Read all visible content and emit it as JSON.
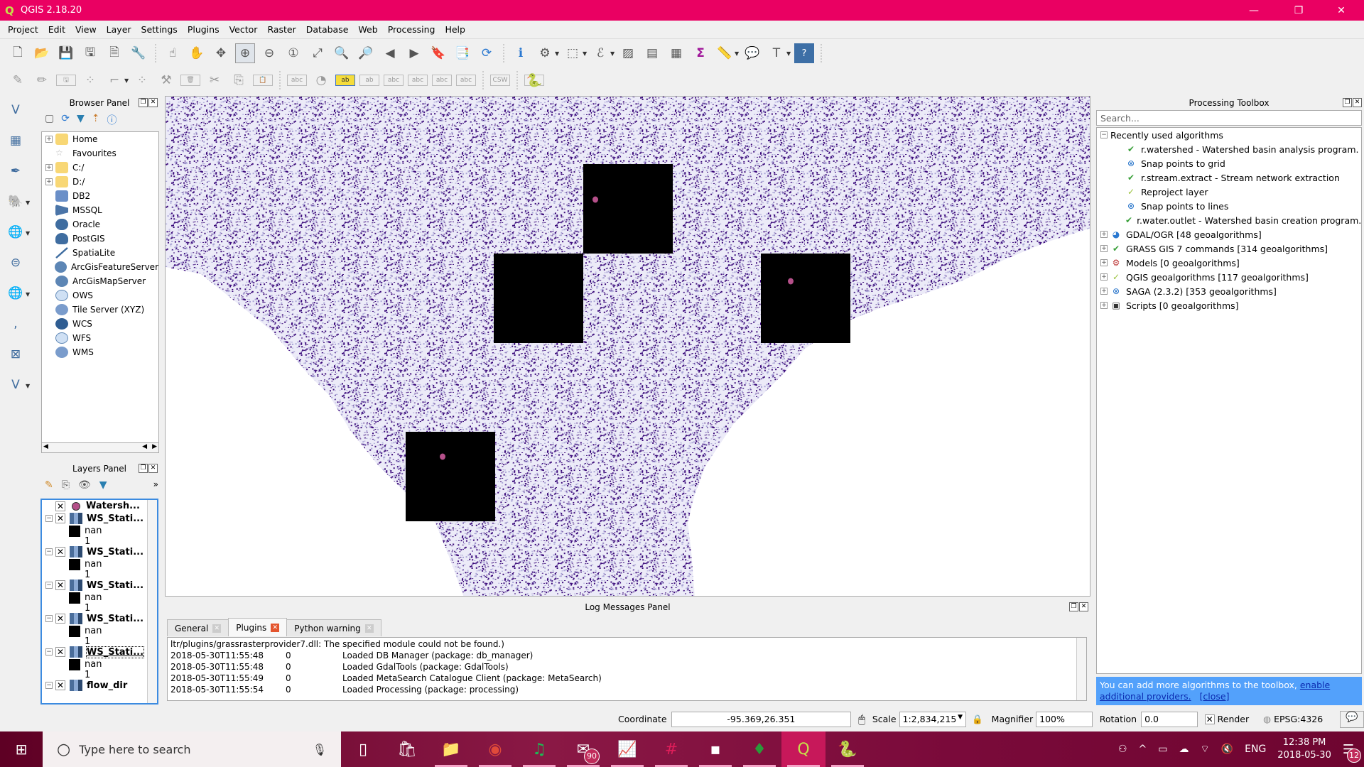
{
  "window": {
    "title": "QGIS 2.18.20",
    "minimize": "—",
    "restore": "❐",
    "close": "✕"
  },
  "menu": [
    "Project",
    "Edit",
    "View",
    "Layer",
    "Settings",
    "Plugins",
    "Vector",
    "Raster",
    "Database",
    "Web",
    "Processing",
    "Help"
  ],
  "toolbar1": [
    {
      "icon": "new-project-icon",
      "glyph": "🗋"
    },
    {
      "icon": "open-project-icon",
      "glyph": "📂"
    },
    {
      "icon": "save-project-icon",
      "glyph": "💾"
    },
    {
      "icon": "save-as-icon",
      "glyph": "🖫"
    },
    {
      "icon": "new-print-composer-icon",
      "glyph": "🗎"
    },
    {
      "icon": "composer-manager-icon",
      "glyph": "🔧"
    },
    {
      "icon": "touch-zoom-icon",
      "glyph": "☝"
    },
    {
      "icon": "pan-icon",
      "glyph": "✋"
    },
    {
      "icon": "pan-to-selection-icon",
      "glyph": "✥"
    },
    {
      "icon": "zoom-in-icon",
      "glyph": "⊕"
    },
    {
      "icon": "zoom-out-icon",
      "glyph": "⊖"
    },
    {
      "icon": "zoom-native-icon",
      "glyph": "①"
    },
    {
      "icon": "zoom-full-icon",
      "glyph": "⤢"
    },
    {
      "icon": "zoom-to-selection-icon",
      "glyph": "🔍"
    },
    {
      "icon": "zoom-to-layer-icon",
      "glyph": "🔎"
    },
    {
      "icon": "zoom-last-icon",
      "glyph": "◀"
    },
    {
      "icon": "zoom-next-icon",
      "glyph": "▶"
    },
    {
      "icon": "new-bookmark-icon",
      "glyph": "🔖"
    },
    {
      "icon": "show-bookmarks-icon",
      "glyph": "📑"
    },
    {
      "icon": "refresh-icon",
      "glyph": "⟳"
    },
    {
      "icon": "identify-icon",
      "glyph": "ℹ"
    },
    {
      "icon": "run-feature-action-icon",
      "glyph": "⚙"
    },
    {
      "icon": "select-features-icon",
      "glyph": "⬚"
    },
    {
      "icon": "select-by-expression-icon",
      "glyph": "ℰ"
    },
    {
      "icon": "deselect-all-icon",
      "glyph": "▨"
    },
    {
      "icon": "attribute-table-icon",
      "glyph": "▤"
    },
    {
      "icon": "field-calculator-icon",
      "glyph": "▦"
    },
    {
      "icon": "statistical-summary-icon",
      "glyph": "Σ"
    },
    {
      "icon": "measure-icon",
      "glyph": "📏"
    },
    {
      "icon": "map-tips-icon",
      "glyph": "💬"
    },
    {
      "icon": "text-annotation-icon",
      "glyph": "T"
    },
    {
      "icon": "help-icon",
      "glyph": "?"
    }
  ],
  "toolbar2": [
    {
      "icon": "current-edits-icon",
      "glyph": "✎"
    },
    {
      "icon": "toggle-editing-icon",
      "glyph": "✏"
    },
    {
      "icon": "save-edits-icon",
      "glyph": "🖫"
    },
    {
      "icon": "add-feature-icon",
      "glyph": "⁘"
    },
    {
      "icon": "node-tool-icon",
      "glyph": "⌐"
    },
    {
      "icon": "move-feature-icon",
      "glyph": "⁘"
    },
    {
      "icon": "vertex-tool-icon",
      "glyph": "⚒"
    },
    {
      "icon": "delete-selected-icon",
      "glyph": "🗑"
    },
    {
      "icon": "cut-features-icon",
      "glyph": "✂"
    },
    {
      "icon": "copy-features-icon",
      "glyph": "⎘"
    },
    {
      "icon": "paste-features-icon",
      "glyph": "📋"
    },
    {
      "icon": "label-toolbar-icon",
      "glyph": "abc"
    },
    {
      "icon": "diagram-icon",
      "glyph": "◔"
    },
    {
      "icon": "pin-labels-icon",
      "glyph": "ab"
    },
    {
      "icon": "highlight-pinned-icon",
      "glyph": "ab"
    },
    {
      "icon": "show-hide-labels-icon",
      "glyph": "abc"
    },
    {
      "icon": "move-label-icon",
      "glyph": "abc"
    },
    {
      "icon": "rotate-label-icon",
      "glyph": "abc"
    },
    {
      "icon": "change-label-icon",
      "glyph": "abc"
    },
    {
      "icon": "csw-icon",
      "glyph": "CSW"
    },
    {
      "icon": "python-console-icon",
      "glyph": "🐍"
    }
  ],
  "left_toolbar": [
    "add-vector-layer-icon",
    "add-raster-layer-icon",
    "add-spatialite-layer-icon",
    "add-postgis-layer-icon",
    "add-wms-layer-icon",
    "add-wcs-layer-icon",
    "add-wfs-layer-icon",
    "add-delimited-text-icon",
    "add-mssql-layer-icon",
    "new-shapefile-icon"
  ],
  "browser_panel": {
    "title": "Browser Panel",
    "items": [
      {
        "label": "Home",
        "icon": "folder-icon",
        "expandable": true
      },
      {
        "label": "Favourites",
        "icon": "star-icon",
        "expandable": false
      },
      {
        "label": "C:/",
        "icon": "folder-icon",
        "expandable": true
      },
      {
        "label": "D:/",
        "icon": "folder-icon",
        "expandable": true
      },
      {
        "label": "DB2",
        "icon": "db2-icon",
        "expandable": false
      },
      {
        "label": "MSSQL",
        "icon": "mssql-icon",
        "expandable": false
      },
      {
        "label": "Oracle",
        "icon": "oracle-icon",
        "expandable": false
      },
      {
        "label": "PostGIS",
        "icon": "postgis-icon",
        "expandable": false
      },
      {
        "label": "SpatiaLite",
        "icon": "spatialite-icon",
        "expandable": false
      },
      {
        "label": "ArcGisFeatureServer",
        "icon": "arcgis-feature-icon",
        "expandable": false
      },
      {
        "label": "ArcGisMapServer",
        "icon": "arcgis-map-icon",
        "expandable": false
      },
      {
        "label": "OWS",
        "icon": "ows-icon",
        "expandable": false
      },
      {
        "label": "Tile Server (XYZ)",
        "icon": "xyz-icon",
        "expandable": false
      },
      {
        "label": "WCS",
        "icon": "wcs-icon",
        "expandable": false
      },
      {
        "label": "WFS",
        "icon": "wfs-icon",
        "expandable": false
      },
      {
        "label": "WMS",
        "icon": "wms-icon",
        "expandable": false
      }
    ]
  },
  "layers_panel": {
    "title": "Layers Panel",
    "layers": [
      {
        "name": "Watersh...",
        "type": "point",
        "checked": true,
        "legend": []
      },
      {
        "name": "WS_Stati...",
        "type": "raster",
        "checked": true,
        "legend": [
          "nan",
          "1"
        ]
      },
      {
        "name": "WS_Stati...",
        "type": "raster",
        "checked": true,
        "legend": [
          "nan",
          "1"
        ]
      },
      {
        "name": "WS_Stati...",
        "type": "raster",
        "checked": true,
        "legend": [
          "nan",
          "1"
        ]
      },
      {
        "name": "WS_Stati...",
        "type": "raster",
        "checked": true,
        "legend": [
          "nan",
          "1"
        ]
      },
      {
        "name": "WS_Stati...",
        "type": "raster",
        "checked": true,
        "legend": [
          "nan",
          "1"
        ],
        "selected": true
      },
      {
        "name": "flow_dir",
        "type": "raster",
        "checked": true,
        "legend": []
      }
    ]
  },
  "map": {
    "raster_color": "#3b0a7a",
    "point_color": "#b5508a",
    "watershed_fill": "#000000"
  },
  "log_panel": {
    "title": "Log Messages Panel",
    "tabs": [
      {
        "label": "General",
        "active": false
      },
      {
        "label": "Plugins",
        "active": true
      },
      {
        "label": "Python warning",
        "active": false
      }
    ],
    "first_line": "ltr/plugins/grassrasterprovider7.dll: The specified module could not be found.)",
    "entries": [
      {
        "ts": "2018-05-30T11:55:48",
        "level": "0",
        "msg": "Loaded DB Manager (package: db_manager)"
      },
      {
        "ts": "2018-05-30T11:55:48",
        "level": "0",
        "msg": "Loaded GdalTools (package: GdalTools)"
      },
      {
        "ts": "2018-05-30T11:55:49",
        "level": "0",
        "msg": "Loaded MetaSearch Catalogue Client (package: MetaSearch)"
      },
      {
        "ts": "2018-05-30T11:55:54",
        "level": "0",
        "msg": "Loaded Processing (package: processing)"
      }
    ]
  },
  "processing": {
    "title": "Processing Toolbox",
    "search_placeholder": "Search...",
    "recent_label": "Recently used algorithms",
    "recent": [
      {
        "label": "r.watershed - Watershed basin analysis program.",
        "icon": "grass-icon"
      },
      {
        "label": "Snap points to grid",
        "icon": "saga-icon"
      },
      {
        "label": "r.stream.extract - Stream network extraction",
        "icon": "grass-icon"
      },
      {
        "label": "Reproject layer",
        "icon": "qgis-icon"
      },
      {
        "label": "Snap points to lines",
        "icon": "saga-icon"
      },
      {
        "label": "r.water.outlet - Watershed basin creation program.",
        "icon": "grass-icon"
      }
    ],
    "providers": [
      {
        "label": "GDAL/OGR [48 geoalgorithms]",
        "icon": "gdal-icon"
      },
      {
        "label": "GRASS GIS 7 commands [314 geoalgorithms]",
        "icon": "grass-icon"
      },
      {
        "label": "Models [0 geoalgorithms]",
        "icon": "models-icon"
      },
      {
        "label": "QGIS geoalgorithms [117 geoalgorithms]",
        "icon": "qgis-icon"
      },
      {
        "label": "SAGA (2.3.2) [353 geoalgorithms]",
        "icon": "saga-icon"
      },
      {
        "label": "Scripts [0 geoalgorithms]",
        "icon": "scripts-icon"
      }
    ],
    "info_text": "You can add more algorithms to the toolbox, ",
    "info_link": "enable additional providers.",
    "info_close": "[close]"
  },
  "statusbar": {
    "coordinate_label": "Coordinate",
    "coordinate": "-95.369,26.351",
    "scale_label": "Scale",
    "scale": "1:2,834,215",
    "magnifier_label": "Magnifier",
    "magnifier": "100%",
    "rotation_label": "Rotation",
    "rotation": "0.0",
    "render_label": "Render",
    "render_checked": true,
    "crs": "EPSG:4326"
  },
  "taskbar": {
    "search_placeholder": "Type here to search",
    "apps": [
      {
        "name": "task-view",
        "glyph": "▯"
      },
      {
        "name": "store",
        "glyph": "🛍"
      },
      {
        "name": "file-explorer",
        "glyph": "📁"
      },
      {
        "name": "chrome",
        "glyph": "◉"
      },
      {
        "name": "spotify",
        "glyph": "♫"
      },
      {
        "name": "mail",
        "glyph": "✉",
        "badge": "90"
      },
      {
        "name": "monitor",
        "glyph": "📈"
      },
      {
        "name": "slack",
        "glyph": "#"
      },
      {
        "name": "terminal",
        "glyph": "▪"
      },
      {
        "name": "grass",
        "glyph": "♦"
      },
      {
        "name": "qgis",
        "glyph": "Q",
        "active": true
      },
      {
        "name": "python-file",
        "glyph": "🐍"
      }
    ],
    "tray": {
      "language": "ENG",
      "time": "12:38 PM",
      "date": "2018-05-30",
      "notifications": "12"
    }
  }
}
